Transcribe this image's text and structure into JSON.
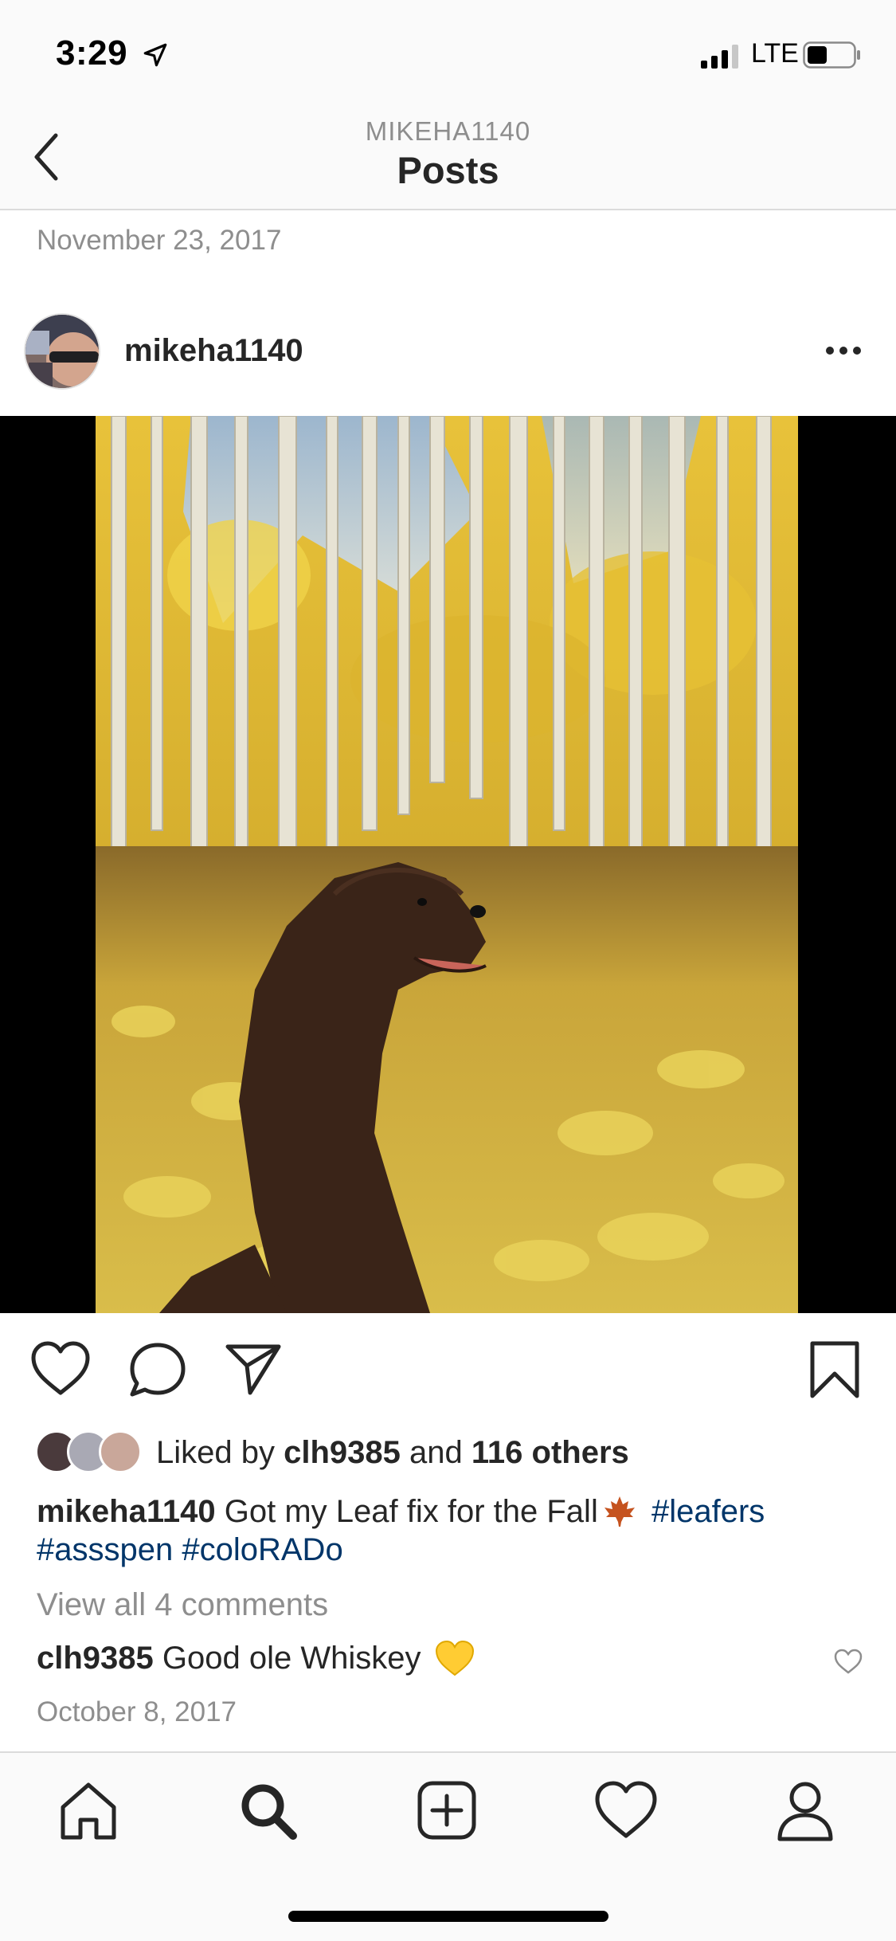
{
  "status_bar": {
    "time": "3:29",
    "carrier": "LTE",
    "icons": [
      "location-arrow-icon",
      "signal-bars-icon",
      "battery-icon"
    ]
  },
  "nav": {
    "subtitle": "MIKEHA1140",
    "title": "Posts",
    "back_icon": "chevron-left-icon"
  },
  "post": {
    "date_header": "November 23, 2017",
    "username": "mikeha1140",
    "more_icon": "more-dots-icon",
    "photo_alt": "Dog in aspen forest",
    "actions": [
      "heart-icon",
      "comment-icon",
      "share-icon",
      "bookmark-icon"
    ],
    "likes": {
      "prefix": "Liked by",
      "user": "clh9385",
      "middle": "and",
      "others": "116 others"
    },
    "caption": {
      "user": "mikeha1140",
      "text": "Got my Leaf fix for the Fall",
      "emoji": "maple-leaf-emoji",
      "hashtags": [
        "#leafers",
        "#assspen",
        "#coloRADo"
      ]
    },
    "view_comments": "View all 4 comments",
    "top_comment": {
      "user": "clh9385",
      "text": "Good ole Whiskey",
      "emoji": "yellow-heart-emoji"
    },
    "date_footer": "October 8, 2017"
  },
  "tabbar": {
    "items": [
      "home-icon",
      "search-icon",
      "add-post-icon",
      "activity-heart-icon",
      "profile-icon"
    ],
    "active": "search-icon"
  }
}
